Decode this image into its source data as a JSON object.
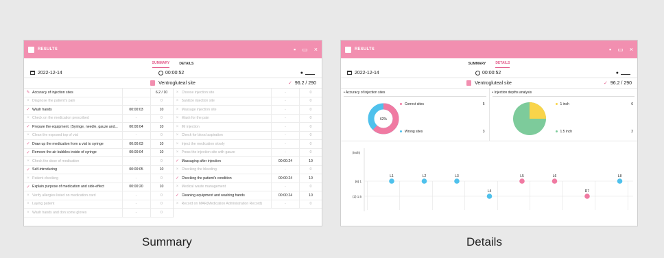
{
  "window": {
    "title": "RESULTS"
  },
  "tabs": {
    "summary": "SUMMARY",
    "details": "DETAILS"
  },
  "info": {
    "date": "2022-12-14",
    "time": "00:00:52"
  },
  "site": {
    "name": "Ventrogluteal site",
    "score": "96.2 / 290"
  },
  "summary": {
    "left": [
      {
        "status": "pencil",
        "name": "Accuracy of injection sites",
        "time": "",
        "score": "6.2 / 10"
      },
      {
        "status": "na",
        "name": "Diagnose the patient's pain",
        "time": "-",
        "score": "0"
      },
      {
        "status": "done",
        "name": "Wash hands",
        "time": "00:00:03",
        "score": "10"
      },
      {
        "status": "na",
        "name": "Check on the medication prescribed",
        "time": "-",
        "score": "0"
      },
      {
        "status": "done",
        "name": "Prepare the equipment. (Syringe, needle, gauze and...",
        "time": "00:00:04",
        "score": "10"
      },
      {
        "status": "na",
        "name": "Clean the exposed top of vial",
        "time": "-",
        "score": "0"
      },
      {
        "status": "done",
        "name": "Draw up the medication from a vial to syringe",
        "time": "00:00:03",
        "score": "10"
      },
      {
        "status": "done",
        "name": "Remove the air bubbles inside of syringe",
        "time": "00:00:04",
        "score": "10"
      },
      {
        "status": "na",
        "name": "Check the dose of medication",
        "time": "-",
        "score": "0"
      },
      {
        "status": "done",
        "name": "Self-introducing",
        "time": "00:00:05",
        "score": "10"
      },
      {
        "status": "na",
        "name": "Patient checking",
        "time": "-",
        "score": "0"
      },
      {
        "status": "done",
        "name": "Explain purpose of medication and side-effect",
        "time": "00:00:20",
        "score": "10"
      },
      {
        "status": "na",
        "name": "Verify allergies listed on medication card",
        "time": "-",
        "score": "0"
      },
      {
        "status": "na",
        "name": "Laying patient",
        "time": "-",
        "score": "0"
      },
      {
        "status": "na",
        "name": "Wash hands and don some gloves",
        "time": "-",
        "score": "0"
      }
    ],
    "right": [
      {
        "status": "na",
        "name": "Choose injection site",
        "time": "-",
        "score": "0"
      },
      {
        "status": "na",
        "name": "Sanitize injection site",
        "time": "-",
        "score": "0"
      },
      {
        "status": "na",
        "name": "Massage injection site",
        "time": "-",
        "score": "0"
      },
      {
        "status": "na",
        "name": "Wash for the pain",
        "time": "-",
        "score": "0"
      },
      {
        "status": "na",
        "name": "IM injection",
        "time": "-",
        "score": "0"
      },
      {
        "status": "na",
        "name": "Check for blood aspiration",
        "time": "-",
        "score": "0"
      },
      {
        "status": "na",
        "name": "Inject the medication slowly",
        "time": "-",
        "score": "0"
      },
      {
        "status": "na",
        "name": "Press the injection site with gauze",
        "time": "-",
        "score": "0"
      },
      {
        "status": "done",
        "name": "Massaging after injection",
        "time": "00:00:24",
        "score": "10"
      },
      {
        "status": "na",
        "name": "Checking the bleeding",
        "time": "-",
        "score": "0"
      },
      {
        "status": "done",
        "name": "Checking the patient's condition",
        "time": "00:00:24",
        "score": "10"
      },
      {
        "status": "na",
        "name": "Medical waste management",
        "time": "-",
        "score": "0"
      },
      {
        "status": "done",
        "name": "Cleaning equipment and washing hands",
        "time": "00:00:24",
        "score": "10"
      },
      {
        "status": "na",
        "name": "Record on MAR(Medication Administration Record)",
        "time": "-",
        "score": "0"
      }
    ]
  },
  "details": {
    "accuracy": {
      "title": "• Accuracy of injection sites",
      "center": "62%",
      "legend": [
        {
          "label": "Correct sites",
          "value": "5",
          "color": "#f07aa2"
        },
        {
          "label": "Wrong sites",
          "value": "3",
          "color": "#4fc1ec"
        }
      ],
      "correct_fraction": 0.62
    },
    "depths": {
      "title": "• Injection depths analysis",
      "legend": [
        {
          "label": "1 inch",
          "value": "6",
          "color": "#f9d44a"
        },
        {
          "label": "1.5 inch",
          "value": "2",
          "color": "#7dcb9b"
        }
      ],
      "fraction_1inch": 0.25
    },
    "depth_plot": {
      "unit": "(inch)",
      "rows": [
        "(6) 1",
        "(2) 1.5"
      ],
      "points": [
        {
          "label": "L1",
          "row": 0,
          "col": 0,
          "color": "#4fc1ec"
        },
        {
          "label": "L2",
          "row": 0,
          "col": 1,
          "color": "#4fc1ec"
        },
        {
          "label": "L3",
          "row": 0,
          "col": 2,
          "color": "#4fc1ec"
        },
        {
          "label": "L4",
          "row": 1,
          "col": 3,
          "color": "#4fc1ec"
        },
        {
          "label": "L5",
          "row": 0,
          "col": 4,
          "color": "#f07aa2"
        },
        {
          "label": "L6",
          "row": 0,
          "col": 5,
          "color": "#f07aa2"
        },
        {
          "label": "R7",
          "row": 1,
          "col": 6,
          "color": "#f07aa2"
        },
        {
          "label": "L8",
          "row": 0,
          "col": 7,
          "color": "#4fc1ec"
        }
      ]
    }
  },
  "captions": {
    "summary": "Summary",
    "details": "Details"
  }
}
